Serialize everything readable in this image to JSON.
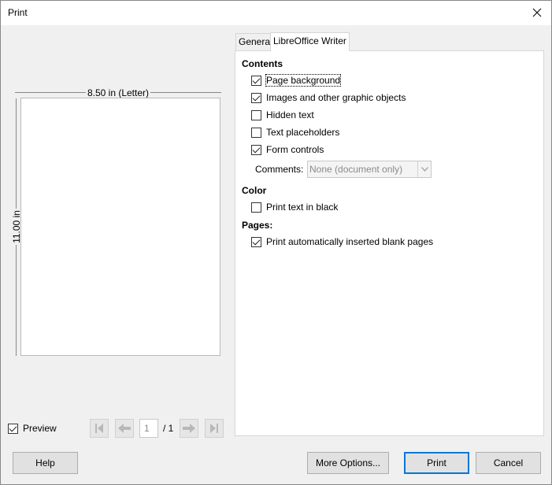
{
  "window": {
    "title": "Print",
    "close_icon": "close-icon"
  },
  "preview": {
    "width_label": "8.50 in (Letter)",
    "height_label": "11.00 in",
    "preview_checkbox": {
      "label": "Preview",
      "checked": true
    },
    "page_number": "1",
    "page_total": "/ 1",
    "nav_icons": [
      "first-page-icon",
      "prev-page-icon",
      "next-page-icon",
      "last-page-icon"
    ]
  },
  "tabs": [
    {
      "label": "General",
      "active": false
    },
    {
      "label": "LibreOffice Writer",
      "active": true
    }
  ],
  "contents": {
    "heading": "Contents",
    "items": [
      {
        "label": "Page background",
        "checked": true
      },
      {
        "label": "Images and other graphic objects",
        "checked": true
      },
      {
        "label": "Hidden text",
        "checked": false
      },
      {
        "label": "Text placeholders",
        "checked": false
      },
      {
        "label": "Form controls",
        "checked": true
      }
    ],
    "comments_label": "Comments:",
    "comments_value": "None (document only)"
  },
  "color": {
    "heading": "Color",
    "items": [
      {
        "label": "Print text in black",
        "checked": false
      }
    ]
  },
  "pages": {
    "heading": "Pages:",
    "items": [
      {
        "label": "Print automatically inserted blank pages",
        "checked": true
      }
    ]
  },
  "buttons": {
    "help": "Help",
    "more_options": "More Options...",
    "print": "Print",
    "cancel": "Cancel"
  }
}
